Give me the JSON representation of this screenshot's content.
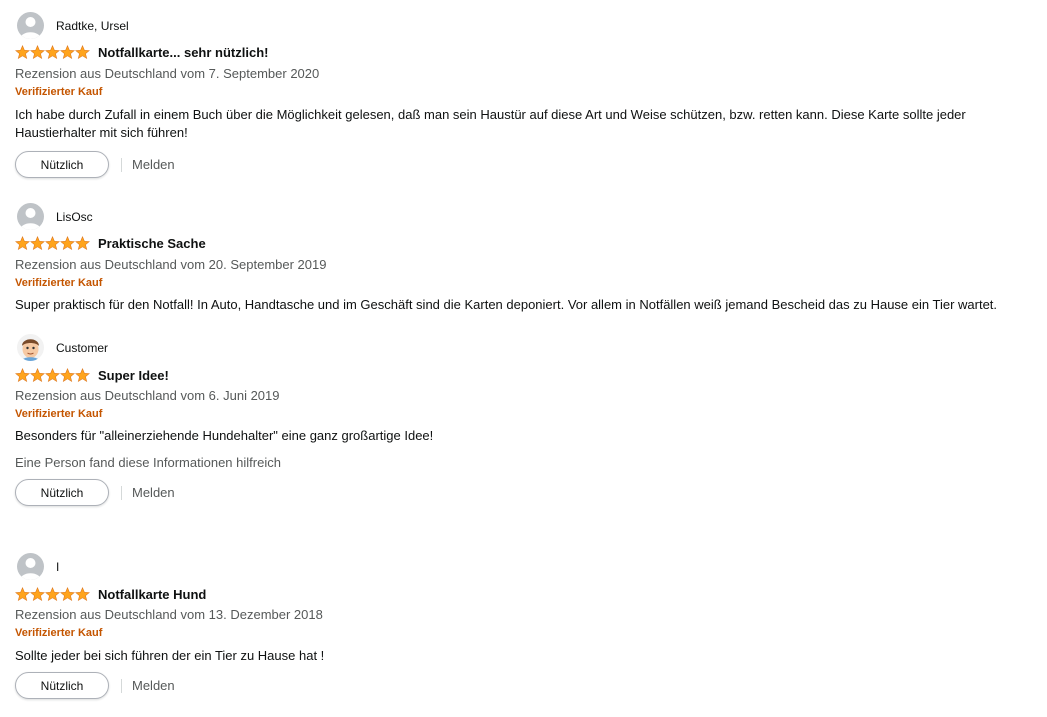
{
  "colors": {
    "star": "#ffa41c",
    "verified": "#c45500",
    "meta": "#565959"
  },
  "reviews": [
    {
      "avatar": "default-avatar-icon",
      "name": "Radtke, Ursel",
      "rating": 5,
      "title": "Notfallkarte... sehr nützlich!",
      "meta": "Rezension aus Deutschland vom 7. September 2020",
      "verified": "Verifizierter Kauf",
      "body": "Ich habe durch Zufall in einem Buch über die Möglichkeit gelesen, daß man sein Haustür auf diese Art und Weise schützen, bzw. retten kann. Diese Karte sollte jeder Haustierhalter mit sich führen!",
      "helpful_text": "",
      "helpful_button": "Nützlich",
      "report": "Melden"
    },
    {
      "avatar": "default-avatar-icon",
      "name": "LisOsc",
      "rating": 5,
      "title": "Praktische Sache",
      "meta": "Rezension aus Deutschland vom 20. September 2019",
      "verified": "Verifizierter Kauf",
      "body": "Super praktisch für den Notfall! In Auto, Handtasche und im Geschäft sind die Karten deponiert. Vor allem in Notfällen weiß jemand Bescheid das zu Hause ein Tier wartet.",
      "helpful_text": "",
      "helpful_button": "",
      "report": ""
    },
    {
      "avatar": "cartoon-face-avatar-icon",
      "name": "Customer",
      "rating": 5,
      "title": "Super Idee!",
      "meta": "Rezension aus Deutschland vom 6. Juni 2019",
      "verified": "Verifizierter Kauf",
      "body": "Besonders für \"alleinerziehende Hundehalter\" eine ganz großartige Idee!",
      "helpful_text": "Eine Person fand diese Informationen hilfreich",
      "helpful_button": "Nützlich",
      "report": "Melden"
    },
    {
      "avatar": "default-avatar-icon",
      "name": "I",
      "rating": 5,
      "title": "Notfallkarte Hund",
      "meta": "Rezension aus Deutschland vom 13. Dezember 2018",
      "verified": "Verifizierter Kauf",
      "body": "Sollte jeder bei sich führen der ein Tier zu Hause hat !",
      "helpful_text": "",
      "helpful_button": "Nützlich",
      "report": "Melden"
    }
  ]
}
